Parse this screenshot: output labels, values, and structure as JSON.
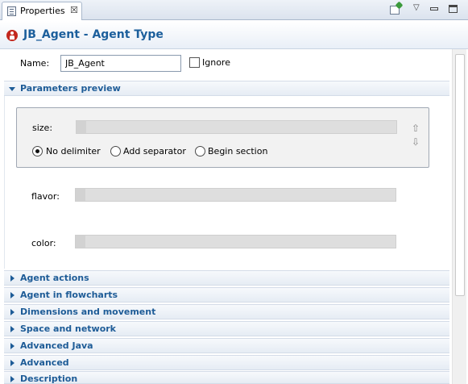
{
  "tab": {
    "label": "Properties",
    "close": "☒"
  },
  "toolbar": {
    "menu": "▽"
  },
  "title": "JB_Agent - Agent Type",
  "name_field": {
    "label": "Name:",
    "value": "JB_Agent"
  },
  "ignore": {
    "label": "Ignore",
    "checked": false
  },
  "parameters_section": {
    "label": "Parameters preview"
  },
  "params": {
    "size_label": "size:",
    "flavor_label": "flavor:",
    "color_label": "color:",
    "radios": [
      "No delimiter",
      "Add separator",
      "Begin section"
    ],
    "selected_radio": "No delimiter",
    "up_arrow": "⇧",
    "down_arrow": "⇩"
  },
  "sections": [
    "Agent actions",
    "Agent in flowcharts",
    "Dimensions and movement",
    "Space and network",
    "Advanced Java",
    "Advanced",
    "Description"
  ],
  "colors": {
    "title": "#1c5f9c",
    "section_text": "#1e5c97",
    "agent_icon": "#c3281e"
  }
}
